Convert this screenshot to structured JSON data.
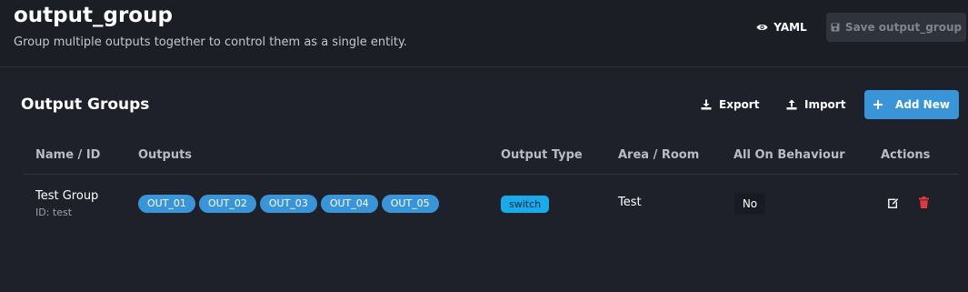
{
  "header": {
    "title": "output_group",
    "subtitle": "Group multiple outputs together to control them as a single entity.",
    "yaml_label": "YAML",
    "save_label": "Save output_group"
  },
  "card": {
    "title": "Output Groups",
    "export_label": "Export",
    "import_label": "Import",
    "add_label": "Add New"
  },
  "table": {
    "columns": [
      "Name / ID",
      "Outputs",
      "Output Type",
      "Area / Room",
      "All On Behaviour",
      "Actions"
    ],
    "rows": [
      {
        "name": "Test Group",
        "id": "ID: test",
        "outputs": [
          "OUT_01",
          "OUT_02",
          "OUT_03",
          "OUT_04",
          "OUT_05"
        ],
        "output_type": "switch",
        "area": "Test",
        "all_on_behaviour": "No"
      }
    ]
  },
  "icons": {
    "yaml": "eye-icon",
    "save": "floppy-icon",
    "export": "download-icon",
    "import": "upload-icon",
    "add": "plus-icon",
    "edit": "edit-icon",
    "delete": "trash-icon"
  },
  "colors": {
    "accent": "#3a95d8",
    "badge": "#1aa9e9",
    "delete": "#e0393e",
    "background": "#1e2129"
  }
}
